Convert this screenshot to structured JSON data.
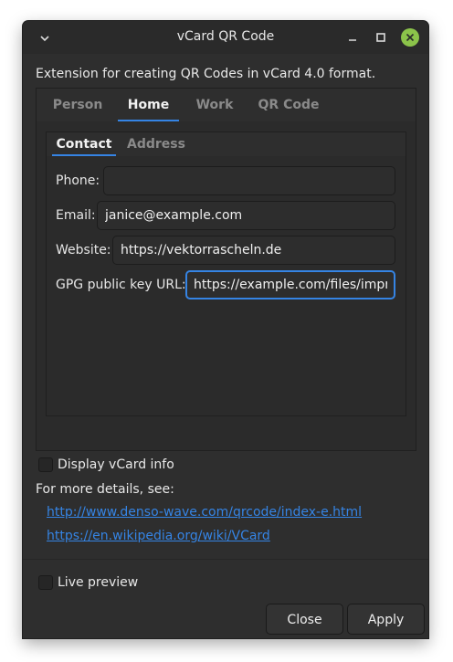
{
  "window": {
    "title": "vCard QR Code"
  },
  "description": "Extension for creating QR Codes in vCard 4.0 format.",
  "tabs": [
    {
      "label": "Person"
    },
    {
      "label": "Home"
    },
    {
      "label": "Work"
    },
    {
      "label": "QR Code"
    }
  ],
  "inner_tabs": [
    {
      "label": "Contact"
    },
    {
      "label": "Address"
    }
  ],
  "fields": {
    "phone": {
      "label": "Phone:",
      "value": ""
    },
    "email": {
      "label": "Email:",
      "value": "janice@example.com"
    },
    "website": {
      "label": "Website:",
      "value": "https://vektorrascheln.de"
    },
    "gpg": {
      "label": "GPG public key URL:",
      "value": "https://example.com/files/impr"
    }
  },
  "options": {
    "display_vcard_info": "Display vCard info",
    "details_text": "For more details, see:",
    "links": [
      "http://www.denso-wave.com/qrcode/index-e.html",
      "https://en.wikipedia.org/wiki/VCard"
    ],
    "live_preview": "Live preview"
  },
  "buttons": {
    "close": "Close",
    "apply": "Apply"
  },
  "colors": {
    "accent": "#3584e4",
    "close_button": "#8bc34a",
    "background": "#2e2e2e"
  }
}
